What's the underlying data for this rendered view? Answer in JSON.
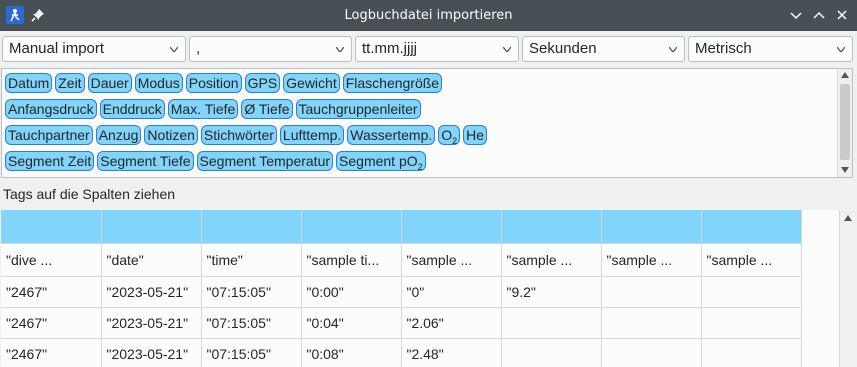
{
  "window": {
    "title": "Logbuchdatei importieren"
  },
  "combos": [
    {
      "value": "Manual import"
    },
    {
      "value": ","
    },
    {
      "value": "tt.mm.jjjj"
    },
    {
      "value": "Sekunden"
    },
    {
      "value": "Metrisch"
    }
  ],
  "tags": {
    "row1": [
      "Datum",
      "Zeit",
      "Dauer",
      "Modus",
      "Position",
      "GPS",
      "Gewicht",
      "Flaschengröße"
    ],
    "row2": [
      "Anfangsdruck",
      "Enddruck",
      "Max. Tiefe",
      "Ø Tiefe",
      "Tauchgruppenleiter"
    ],
    "row3": [
      "Tauchpartner",
      "Anzug",
      "Notizen",
      "Stichwörter",
      "Lufttemp.",
      "Wassertemp.",
      "O",
      "He"
    ],
    "row3_sub": "2",
    "row4": [
      "Segment Zeit",
      "Segment Tiefe",
      "Segment Temperatur",
      "Segment pO"
    ],
    "row4_sub": "2"
  },
  "hint": "Tags auf die Spalten ziehen",
  "table": {
    "headers": [
      "\"dive ...",
      "\"date\"",
      "\"time\"",
      "\"sample ti...",
      "\"sample ...",
      "\"sample ...",
      "\"sample ...",
      "\"sample ..."
    ],
    "rows": [
      [
        "\"2467\"",
        "\"2023-05-21\"",
        "\"07:15:05\"",
        "\"0:00\"",
        "\"0\"",
        "\"9.2\"",
        "",
        ""
      ],
      [
        "\"2467\"",
        "\"2023-05-21\"",
        "\"07:15:05\"",
        "\"0:04\"",
        "\"2.06\"",
        "",
        "",
        ""
      ],
      [
        "\"2467\"",
        "\"2023-05-21\"",
        "\"07:15:05\"",
        "\"0:08\"",
        "\"2.48\"",
        "",
        "",
        ""
      ]
    ]
  },
  "colors": {
    "titlebar": "#475057",
    "tag_fill": "#81d4fa",
    "tag_border": "#2b7ed8",
    "app_icon": "#2a6ad1"
  },
  "icons": [
    "app-icon",
    "pin-icon",
    "minimize-icon",
    "maximize-icon",
    "close-icon",
    "chevron-down-icon",
    "scroll-up-arrow-icon",
    "scroll-down-arrow-icon"
  ]
}
